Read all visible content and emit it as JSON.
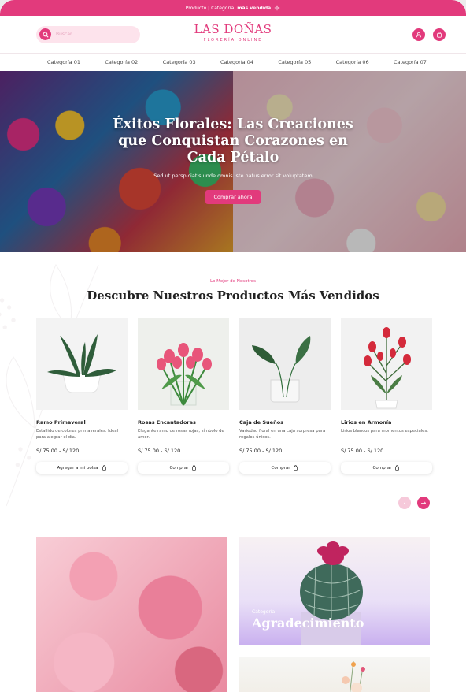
{
  "topbar": {
    "text": "Producto | Categoría",
    "bold": "más vendida"
  },
  "search": {
    "placeholder": "Buscar..."
  },
  "logo": {
    "main": "LAS DOÑAS",
    "sub": "FLORERÍA ONLINE"
  },
  "nav": [
    "Categoría 01",
    "Categoría 02",
    "Categoría 03",
    "Categoría 04",
    "Categoría 05",
    "Categoría 06",
    "Categoría 07"
  ],
  "hero": {
    "title": "Éxitos Florales: Las Creaciones que Conquistan Corazones en Cada Pétalo",
    "subtitle": "Sed ut perspiciatis unde omnis iste natus error sit voluptatem",
    "cta": "Comprar ahora"
  },
  "featured": {
    "eyebrow": "Lo Mejor de Nosotros",
    "title": "Descubre Nuestros Productos Más Vendidos",
    "products": [
      {
        "name": "Ramo Primaveral",
        "desc": "Estallido de colores primaverales. Ideal para alegrar el día.",
        "price": "S/ 75.00 - S/ 120",
        "button": "Agregar a mi bolsa"
      },
      {
        "name": "Rosas Encantadoras",
        "desc": "Elegante ramo de rosas rojas, símbolo de amor.",
        "price": "S/ 75.00 - S/ 120",
        "button": "Comprar"
      },
      {
        "name": "Caja de Sueños",
        "desc": "Variedad floral en una caja sorpresa para regalos únicos.",
        "price": "S/ 75.00 - S/ 120",
        "button": "Comprar"
      },
      {
        "name": "Lirios en Armonía",
        "desc": "Lirios blancos para momentos especiales.",
        "price": "S/ 75.00 - S/ 120",
        "button": "Comprar"
      }
    ]
  },
  "category_card": {
    "label": "Categoría",
    "name": "Agradecimiento"
  },
  "colors": {
    "brand": "#e23a7c",
    "brand_light": "#fde3ec"
  }
}
